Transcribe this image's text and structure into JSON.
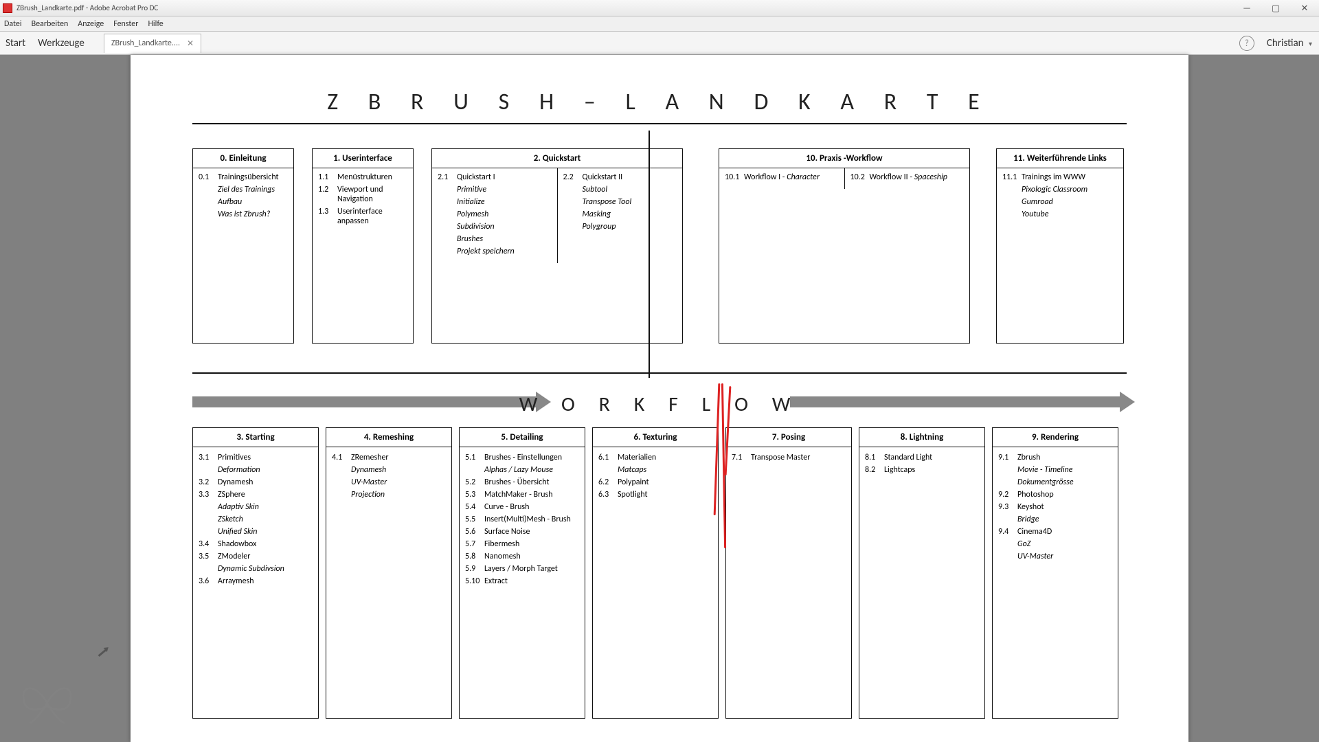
{
  "window": {
    "title": "ZBrush_Landkarte.pdf - Adobe Acrobat Pro DC"
  },
  "menubar": {
    "items": [
      "Datei",
      "Bearbeiten",
      "Anzeige",
      "Fenster",
      "Hilfe"
    ]
  },
  "toolbar": {
    "start": "Start",
    "tools": "Werkzeuge",
    "tab_label": "ZBrush_Landkarte....",
    "user": "Christian"
  },
  "doc": {
    "title": "Z B R U S H – L A N D K A R T E",
    "workflow_label": "W O R K F L O W"
  },
  "top_cards": {
    "c0": {
      "title": "0. Einleitung",
      "items": [
        {
          "num": "0.1",
          "txt": "Trainingsübersicht"
        }
      ],
      "subs": [
        "Ziel des Trainings",
        "Aufbau",
        "Was ist Zbrush?"
      ]
    },
    "c1": {
      "title": "1. Userinterface",
      "items": [
        {
          "num": "1.1",
          "txt": "Menüstrukturen"
        },
        {
          "num": "1.2",
          "txt": "Viewport und Navigation"
        },
        {
          "num": "1.3",
          "txt": "Userinterface anpassen"
        }
      ]
    },
    "c2": {
      "title": "2. Quickstart",
      "left": {
        "head": {
          "num": "2.1",
          "txt": "Quickstart I"
        },
        "subs": [
          "Primitive",
          "Initialize",
          "Polymesh",
          "Subdivision",
          "Brushes",
          "Projekt speichern"
        ]
      },
      "right": {
        "head": {
          "num": "2.2",
          "txt": "Quickstart II"
        },
        "subs": [
          "Subtool",
          "Transpose Tool",
          "Masking",
          "Polygroup"
        ]
      }
    },
    "c3": {
      "title": "10. Praxis -Workflow",
      "left": {
        "num": "10.1",
        "txt": "Workflow I - ",
        "em": "Character"
      },
      "right": {
        "num": "10.2",
        "txt": "Workflow II - ",
        "em": "Spaceship"
      }
    },
    "c4": {
      "title": "11. Weiterführende Links",
      "items": [
        {
          "num": "11.1",
          "txt": "Trainings im WWW"
        }
      ],
      "subs": [
        "Pixologic Classroom",
        "Gumroad",
        "Youtube"
      ]
    }
  },
  "workflow_cards": {
    "w3": {
      "title": "3. Starting",
      "rows": [
        {
          "num": "3.1",
          "txt": "Primitives",
          "subs": [
            "Deformation"
          ]
        },
        {
          "num": "3.2",
          "txt": "Dynamesh"
        },
        {
          "num": "3.3",
          "txt": "ZSphere",
          "subs": [
            "Adaptiv Skin",
            "ZSketch",
            "Unified Skin"
          ]
        },
        {
          "num": "3.4",
          "txt": "Shadowbox"
        },
        {
          "num": "3.5",
          "txt": "ZModeler",
          "subs": [
            "Dynamic Subdivsion"
          ]
        },
        {
          "num": "3.6",
          "txt": "Arraymesh"
        }
      ]
    },
    "w4": {
      "title": "4. Remeshing",
      "rows": [
        {
          "num": "4.1",
          "txt": "ZRemesher",
          "subs": [
            "Dynamesh",
            "UV-Master",
            "Projection"
          ]
        }
      ]
    },
    "w5": {
      "title": "5. Detailing",
      "rows": [
        {
          "num": "5.1",
          "txt": "Brushes - Einstellungen",
          "subs": [
            "Alphas / Lazy Mouse"
          ]
        },
        {
          "num": "5.2",
          "txt": "Brushes - Übersicht"
        },
        {
          "num": "5.3",
          "txt": "MatchMaker - Brush"
        },
        {
          "num": "5.4",
          "txt": "Curve - Brush"
        },
        {
          "num": "5.5",
          "txt": "Insert(Multi)Mesh - Brush"
        },
        {
          "num": "5.6",
          "txt": "Surface Noise"
        },
        {
          "num": "5.7",
          "txt": "Fibermesh"
        },
        {
          "num": "5.8",
          "txt": "Nanomesh"
        },
        {
          "num": "5.9",
          "txt": "Layers / Morph Target"
        },
        {
          "num": "5.10",
          "txt": "Extract"
        }
      ]
    },
    "w6": {
      "title": "6. Texturing",
      "rows": [
        {
          "num": "6.1",
          "txt": "Materialien",
          "subs": [
            "Matcaps"
          ]
        },
        {
          "num": "6.2",
          "txt": "Polypaint"
        },
        {
          "num": "6.3",
          "txt": "Spotlight"
        }
      ]
    },
    "w7": {
      "title": "7. Posing",
      "rows": [
        {
          "num": "7.1",
          "txt": "Transpose Master"
        }
      ]
    },
    "w8": {
      "title": "8. Lightning",
      "rows": [
        {
          "num": "8.1",
          "txt": "Standard Light"
        },
        {
          "num": "8.2",
          "txt": "Lightcaps"
        }
      ]
    },
    "w9": {
      "title": "9. Rendering",
      "rows": [
        {
          "num": "9.1",
          "txt": "Zbrush",
          "subs": [
            "Movie - Timeline",
            "Dokumentgrösse"
          ]
        },
        {
          "num": "9.2",
          "txt": "Photoshop"
        },
        {
          "num": "9.3",
          "txt": "Keyshot",
          "subs": [
            "Bridge"
          ]
        },
        {
          "num": "9.4",
          "txt": "Cinema4D",
          "subs": [
            "GoZ",
            "UV-Master"
          ]
        }
      ]
    }
  }
}
